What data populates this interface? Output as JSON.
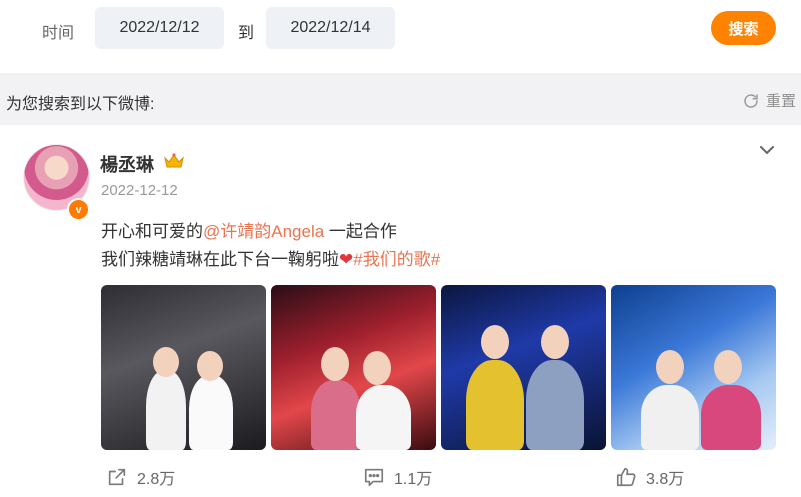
{
  "filter": {
    "time_label": "时间",
    "date_from": "2022/12/12",
    "to_label": "到",
    "date_to": "2022/12/14",
    "search_button": "搜索",
    "accent_color": "#ff8200"
  },
  "results": {
    "title": "为您搜索到以下微博:",
    "reset_label": "重置"
  },
  "post": {
    "username": "楊丞琳",
    "date": "2022-12-12",
    "verified_icon": "v-badge-icon",
    "line1_prefix": "开心和可爱的",
    "line1_mention": "@许靖韵Angela",
    "line1_suffix": " 一起合作",
    "line2_prefix": "我们辣糖靖琳在此下台一鞠躬啦",
    "line2_heart": "❤",
    "line2_topic": "#我们的歌#",
    "photo_count": 4
  },
  "actions": {
    "repost_count": "2.8万",
    "comment_count": "1.1万",
    "like_count": "3.8万"
  }
}
